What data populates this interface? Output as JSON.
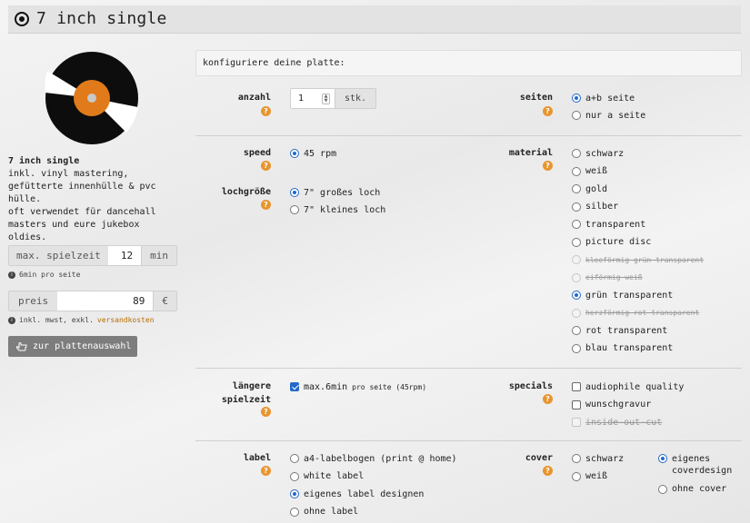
{
  "page": {
    "title": "7 inch single",
    "title_icon": "target-icon"
  },
  "product": {
    "name": "7 inch single",
    "desc_lines": [
      "inkl. vinyl mastering,",
      "gefütterte innenhülle & pvc",
      "hülle.",
      "oft verwendet für dancehall",
      "masters und eure jukebox",
      "oldies."
    ],
    "playtime": {
      "label": "max. spielzeit",
      "value": "12",
      "unit": "min"
    },
    "playtime_note": "6min pro seite",
    "price": {
      "label": "preis",
      "value": "89",
      "unit": "€"
    },
    "price_note_prefix": "inkl. mwst, exkl.",
    "price_note_link": "versandkosten",
    "back_button": "zur plattenauswahl"
  },
  "config": {
    "heading": "konfiguriere deine platte:",
    "anzahl": {
      "label": "anzahl",
      "value": "1",
      "unit": "stk."
    },
    "seiten": {
      "label": "seiten",
      "options": [
        "a+b seite",
        "nur a seite"
      ]
    },
    "speed": {
      "label": "speed",
      "options": [
        "45 rpm"
      ]
    },
    "lochgroesse": {
      "label": "lochgröße",
      "options": [
        "7\" großes loch",
        "7\" kleines loch"
      ]
    },
    "material": {
      "label": "material",
      "options": [
        "schwarz",
        "weiß",
        "gold",
        "silber",
        "transparent",
        "picture disc",
        "kleeförmig grün transparent",
        "eiförmig weiß",
        "grün transparent",
        "herzförmig rot transparent",
        "rot transparent",
        "blau transparent"
      ]
    },
    "laengere": {
      "label_line1": "längere",
      "label_line2": "spielzeit",
      "option": "max.6min",
      "option_small": "pro seite (45rpm)"
    },
    "specials": {
      "label": "specials",
      "options": [
        "audiophile quality",
        "wunschgravur",
        "inside-out-cut"
      ]
    },
    "label": {
      "label": "label",
      "options": [
        "a4-labelbogen (print @ home)",
        "white label",
        "eigenes label designen",
        "ohne label"
      ]
    },
    "cover": {
      "label": "cover",
      "options_col1": [
        "schwarz",
        "weiß"
      ],
      "options_col2": [
        "eigenes",
        "ohne cover"
      ],
      "option_col2_line2": "coverdesign"
    },
    "help_glyph": "?"
  },
  "colors": {
    "accent_orange": "#e8952f",
    "radio_blue": "#2369c9",
    "vinyl_label": "#e07a1a"
  }
}
